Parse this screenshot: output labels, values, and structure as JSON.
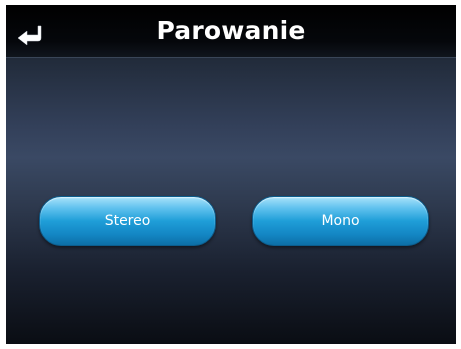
{
  "header": {
    "title": "Parowanie",
    "back_icon": "return-arrow-icon"
  },
  "buttons": {
    "stereo_label": "Stereo",
    "mono_label": "Mono"
  },
  "colors": {
    "header_bg": "#000000",
    "button_top": "#a9e2fa",
    "button_bottom": "#0d6fa6",
    "background_mid": "#3a4964"
  }
}
